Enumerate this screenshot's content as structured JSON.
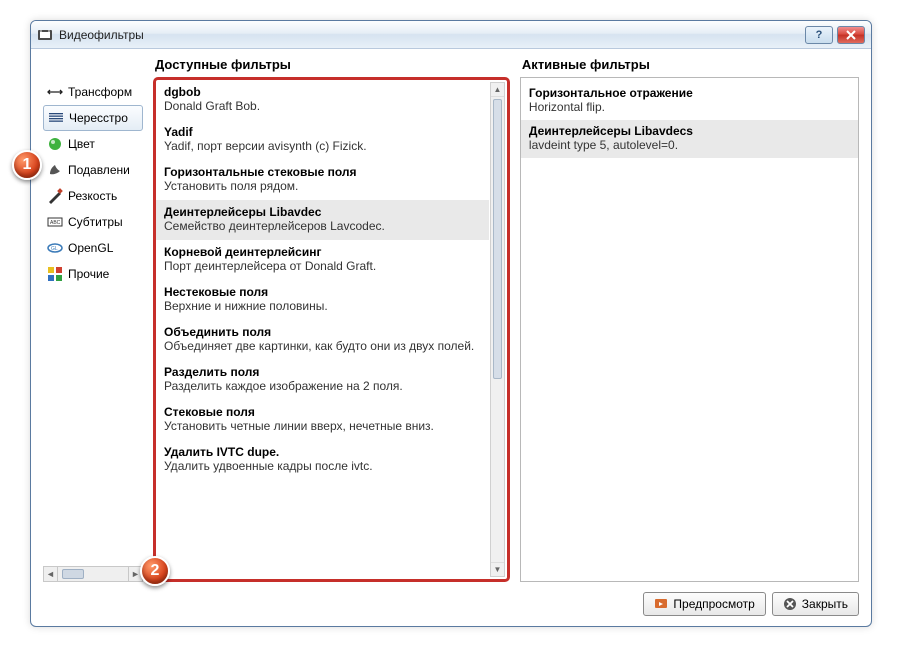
{
  "window": {
    "title": "Видеофильтры"
  },
  "badges": {
    "b1": "1",
    "b2": "2"
  },
  "sidebar": {
    "items": [
      {
        "label": "Трансформ",
        "icon": "transform-icon"
      },
      {
        "label": "Чересстро",
        "icon": "interlace-icon"
      },
      {
        "label": "Цвет",
        "icon": "color-icon"
      },
      {
        "label": "Подавлени",
        "icon": "noise-icon"
      },
      {
        "label": "Резкость",
        "icon": "sharpness-icon"
      },
      {
        "label": "Субтитры",
        "icon": "subtitles-icon"
      },
      {
        "label": "OpenGL",
        "icon": "opengl-icon"
      },
      {
        "label": "Прочие",
        "icon": "other-icon"
      }
    ]
  },
  "available": {
    "header": "Доступные фильтры",
    "items": [
      {
        "name": "dgbob",
        "desc": "Donald Graft Bob."
      },
      {
        "name": "Yadif",
        "desc": "Yadif, порт версии avisynth (c) Fizick."
      },
      {
        "name": "Горизонтальные стековые поля",
        "desc": "Установить поля рядом."
      },
      {
        "name": "Деинтерлейсеры Libavdec",
        "desc": "Семейство деинтерлейсеров Lavcodec."
      },
      {
        "name": "Корневой деинтерлейсинг",
        "desc": "Порт деинтерлейсера от Donald Graft."
      },
      {
        "name": "Нестековые поля",
        "desc": "Верхние и нижние половины."
      },
      {
        "name": "Объединить поля",
        "desc": "Объединяет две картинки, как будто они из двух полей."
      },
      {
        "name": "Разделить поля",
        "desc": "Разделить каждое изображение на 2 поля."
      },
      {
        "name": "Стековые поля",
        "desc": "Установить четные линии вверх, нечетные вниз."
      },
      {
        "name": "Удалить IVTC dupe.",
        "desc": "Удалить удвоенные кадры после ivtc."
      }
    ],
    "selected_index": 3
  },
  "active": {
    "header": "Активные фильтры",
    "items": [
      {
        "name": "Горизонтальное отражение",
        "desc": "Horizontal flip."
      },
      {
        "name": "Деинтерлейсеры Libavdecs",
        "desc": "lavdeint type 5, autolevel=0."
      }
    ],
    "selected_index": 1
  },
  "buttons": {
    "preview": "Предпросмотр",
    "close": "Закрыть"
  }
}
